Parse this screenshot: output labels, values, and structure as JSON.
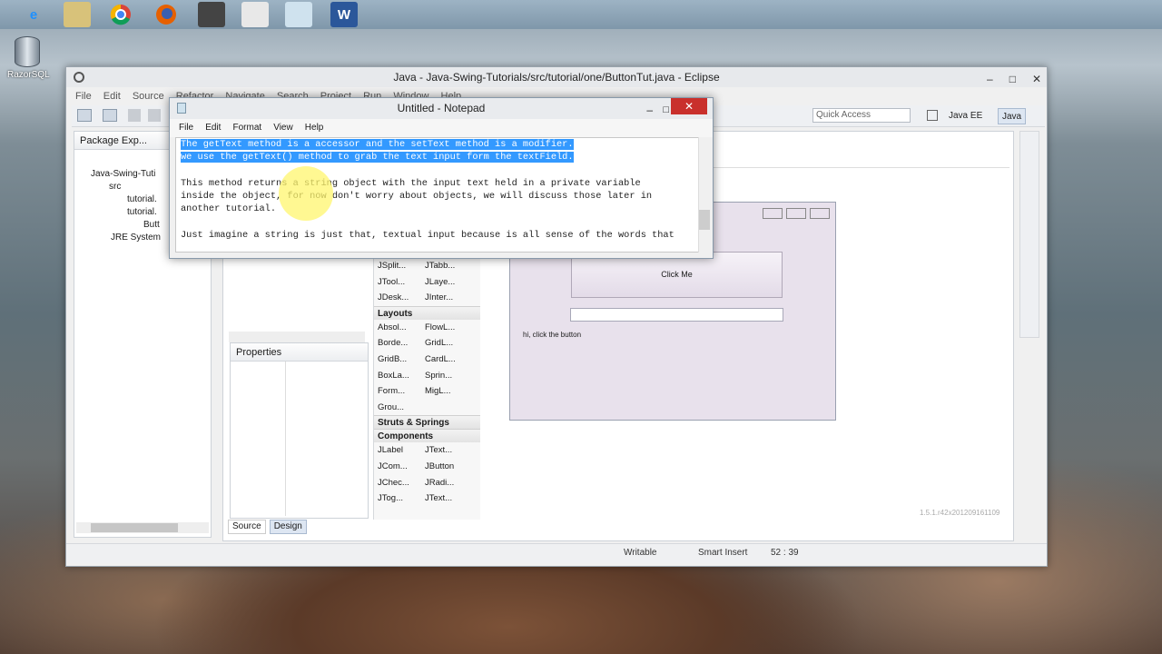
{
  "desktop": {
    "razorsql_label": "RazorSQL",
    "taskbar_icons": [
      "ie-icon",
      "file-explorer-icon",
      "chrome-icon",
      "firefox-icon",
      "ide-icon",
      "app-icon",
      "notepad-icon",
      "word-icon"
    ]
  },
  "eclipse": {
    "title": "Java - Java-Swing-Tutorials/src/tutorial/one/ButtonTut.java - Eclipse",
    "menu": [
      "File",
      "Edit",
      "Source",
      "Refactor",
      "Navigate",
      "Search",
      "Project",
      "Run",
      "Window",
      "Help"
    ],
    "quick_access": "Quick Access",
    "perspectives": [
      "Java EE",
      "Java"
    ],
    "package_explorer": {
      "tab_label": "Package Exp...",
      "tree": [
        "Java-Swing-Tuti",
        "src",
        "tutorial.",
        "tutorial.",
        "Butt",
        "JRE System"
      ]
    },
    "palette": {
      "rows_top": [
        [
          "JSplit...",
          "JTabb..."
        ],
        [
          "JTool...",
          "JLaye..."
        ],
        [
          "JDesk...",
          "JInter..."
        ]
      ],
      "layouts_header": "Layouts",
      "layouts": [
        [
          "Absol...",
          "FlowL..."
        ],
        [
          "Borde...",
          "GridL..."
        ],
        [
          "GridB...",
          "CardL..."
        ],
        [
          "BoxLa...",
          "Sprin..."
        ],
        [
          "Form...",
          "MigL..."
        ],
        [
          "Grou...",
          ""
        ]
      ],
      "struts_header": "Struts & Springs",
      "components_header": "Components",
      "components": [
        [
          "JLabel",
          "JText..."
        ],
        [
          "JCom...",
          "JButton"
        ],
        [
          "JChec...",
          "JRadi..."
        ],
        [
          "JTog...",
          "JText..."
        ]
      ]
    },
    "properties_label": "Properties",
    "design_preview": {
      "button_label": "Click Me",
      "label_text": "hi, click the button"
    },
    "version_text": "1.5.1.r42x201209161109",
    "tabs": {
      "source": "Source",
      "design": "Design"
    },
    "status": {
      "writable": "Writable",
      "insert_mode": "Smart Insert",
      "position": "52 : 39"
    }
  },
  "notepad": {
    "title": "Untitled - Notepad",
    "menu": [
      "File",
      "Edit",
      "Format",
      "View",
      "Help"
    ],
    "lines": [
      "The getText method is a accessor and the setText method is a modifier.",
      "we use the getText() method to grab the text input form the textField.",
      "",
      "This method returns a string object with the input text held in a private variable",
      "inside the object, for now don't worry about objects, we will discuss those later in",
      "another tutorial.",
      "",
      "Just imagine a string is just that, textual input because is all sense of the words that"
    ]
  }
}
